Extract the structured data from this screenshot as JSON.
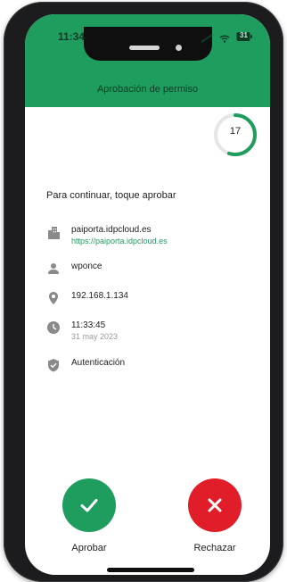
{
  "status_bar": {
    "time": "11:34",
    "icons": [
      "signal-icon",
      "wifi-icon",
      "battery-icon"
    ],
    "battery_label": "31"
  },
  "header": {
    "title": "Aprobación de permiso",
    "background": "#1f9d5e"
  },
  "countdown": {
    "value": "17",
    "accent": "#1f9d5e"
  },
  "instruction": "Para continuar, toque aprobar",
  "details": {
    "site_name": "paiporta.idpcloud.es",
    "site_url": "https://paiporta.idpcloud.es",
    "user": "wponce",
    "ip": "192.168.1.134",
    "time": "11:33:45",
    "date": "31 may 2023",
    "action": "Autenticación"
  },
  "actions": {
    "approve_label": "Aprobar",
    "reject_label": "Rechazar",
    "approve_color": "#1f9d5e",
    "reject_color": "#e11d2a"
  }
}
